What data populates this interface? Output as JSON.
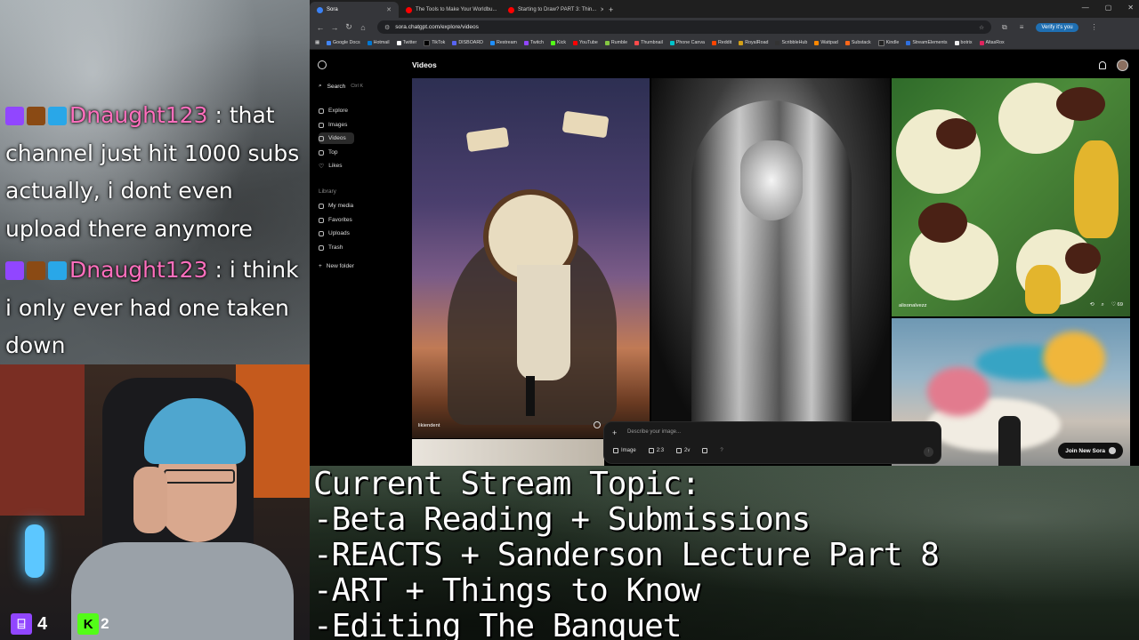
{
  "chat": {
    "messages": [
      {
        "user": "Dnaught123",
        "text": " : that channel just hit 1000 subs actually, i dont even upload there anymore"
      },
      {
        "user": "Dnaught123",
        "text": " : i think i only ever had one taken down"
      }
    ]
  },
  "stream_stats": {
    "twitch_viewers": "4",
    "kick_viewers": "2"
  },
  "browser": {
    "tabs": [
      {
        "title": "Sora",
        "active": true
      },
      {
        "title": "The Tools to Make Your Worldbu..."
      },
      {
        "title": "Starting to Draw? PART 3: Thin..."
      }
    ],
    "url": "sora.chatgpt.com/explore/videos",
    "verify_label": "Verify it's you",
    "bookmarks": [
      "Google Docs",
      "Hotmail",
      "Twitter",
      "TikTok",
      "DISBOARD",
      "Restream",
      "Twitch",
      "Kick",
      "YouTube",
      "Rumble",
      "Thumbnail",
      "Phone Canva",
      "Reddit",
      "RoyalRoad",
      "ScribbleHub",
      "Wattpad",
      "Substack",
      "Kindle",
      "StreamElements",
      "botrix",
      "AltasRox"
    ]
  },
  "sora": {
    "search_label": "Search",
    "search_shortcut": "Ctrl K",
    "nav": [
      "Explore",
      "Images",
      "Videos",
      "Top",
      "Likes"
    ],
    "library_label": "Library",
    "library": [
      "My media",
      "Favorites",
      "Uploads",
      "Trash"
    ],
    "new_folder": "New folder",
    "page_title": "Videos",
    "tiles": {
      "t1_author": "likiendent",
      "t3_author": "alisonalvezz",
      "t3_likes": "69"
    },
    "join_label": "Join New Sora",
    "composer": {
      "placeholder": "Describe your image...",
      "type": "Image",
      "ratio": "2:3",
      "variants": "2v"
    }
  },
  "topic": {
    "lines": [
      "Current Stream Topic:",
      "-Beta Reading + Submissions",
      "-REACTS + Sanderson Lecture Part 8",
      "-ART + Things to Know",
      "-Editing The Banquet"
    ]
  }
}
